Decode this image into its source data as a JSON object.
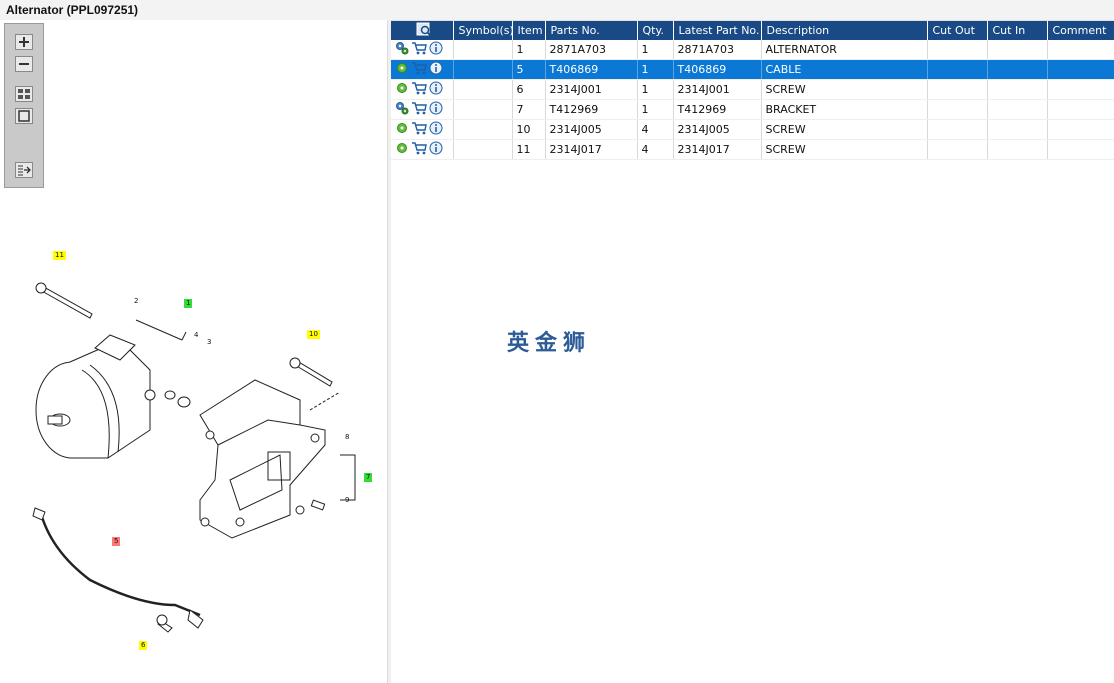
{
  "window": {
    "title": "Alternator (PPL097251)"
  },
  "toolbar": {
    "icons": [
      "zoom-in-icon",
      "zoom-out-icon",
      "fit-all-icon",
      "fit-window-icon",
      "layout-toggle-icon"
    ]
  },
  "diagram": {
    "callouts": [
      {
        "label": "11",
        "color": "yellow"
      },
      {
        "label": "2",
        "color": "plain"
      },
      {
        "label": "1",
        "color": "green"
      },
      {
        "label": "4",
        "color": "plain"
      },
      {
        "label": "3",
        "color": "plain"
      },
      {
        "label": "10",
        "color": "yellow"
      },
      {
        "label": "8",
        "color": "plain"
      },
      {
        "label": "7",
        "color": "green"
      },
      {
        "label": "9",
        "color": "plain"
      },
      {
        "label": "5",
        "color": "red"
      },
      {
        "label": "6",
        "color": "yellow"
      }
    ]
  },
  "table": {
    "columns": [
      "",
      "Symbol(s)",
      "Item",
      "Parts No.",
      "Qty.",
      "Latest Part No.",
      "Description",
      "Cut Out",
      "Cut In",
      "Comment"
    ],
    "rows": [
      {
        "icon_set": "gears",
        "symbols": "",
        "item": "1",
        "part_no": "2871A703",
        "qty": "1",
        "latest_part_no": "2871A703",
        "description": "ALTERNATOR",
        "cut_out": "",
        "cut_in": "",
        "comment": "",
        "selected": false
      },
      {
        "icon_set": "gear",
        "symbols": "",
        "item": "5",
        "part_no": "T406869",
        "qty": "1",
        "latest_part_no": "T406869",
        "description": "CABLE",
        "cut_out": "",
        "cut_in": "",
        "comment": "",
        "selected": true
      },
      {
        "icon_set": "gear",
        "symbols": "",
        "item": "6",
        "part_no": "2314J001",
        "qty": "1",
        "latest_part_no": "2314J001",
        "description": "SCREW",
        "cut_out": "",
        "cut_in": "",
        "comment": "",
        "selected": false
      },
      {
        "icon_set": "gears",
        "symbols": "",
        "item": "7",
        "part_no": "T412969",
        "qty": "1",
        "latest_part_no": "T412969",
        "description": "BRACKET",
        "cut_out": "",
        "cut_in": "",
        "comment": "",
        "selected": false
      },
      {
        "icon_set": "gear",
        "symbols": "",
        "item": "10",
        "part_no": "2314J005",
        "qty": "4",
        "latest_part_no": "2314J005",
        "description": "SCREW",
        "cut_out": "",
        "cut_in": "",
        "comment": "",
        "selected": false
      },
      {
        "icon_set": "gear",
        "symbols": "",
        "item": "11",
        "part_no": "2314J017",
        "qty": "4",
        "latest_part_no": "2314J017",
        "description": "SCREW",
        "cut_out": "",
        "cut_in": "",
        "comment": "",
        "selected": false
      }
    ]
  },
  "watermark": {
    "text": "英金狮"
  },
  "colors": {
    "header": "#1a4a86",
    "selected_row": "#0a78d4",
    "watermark": "#2d5b96"
  }
}
